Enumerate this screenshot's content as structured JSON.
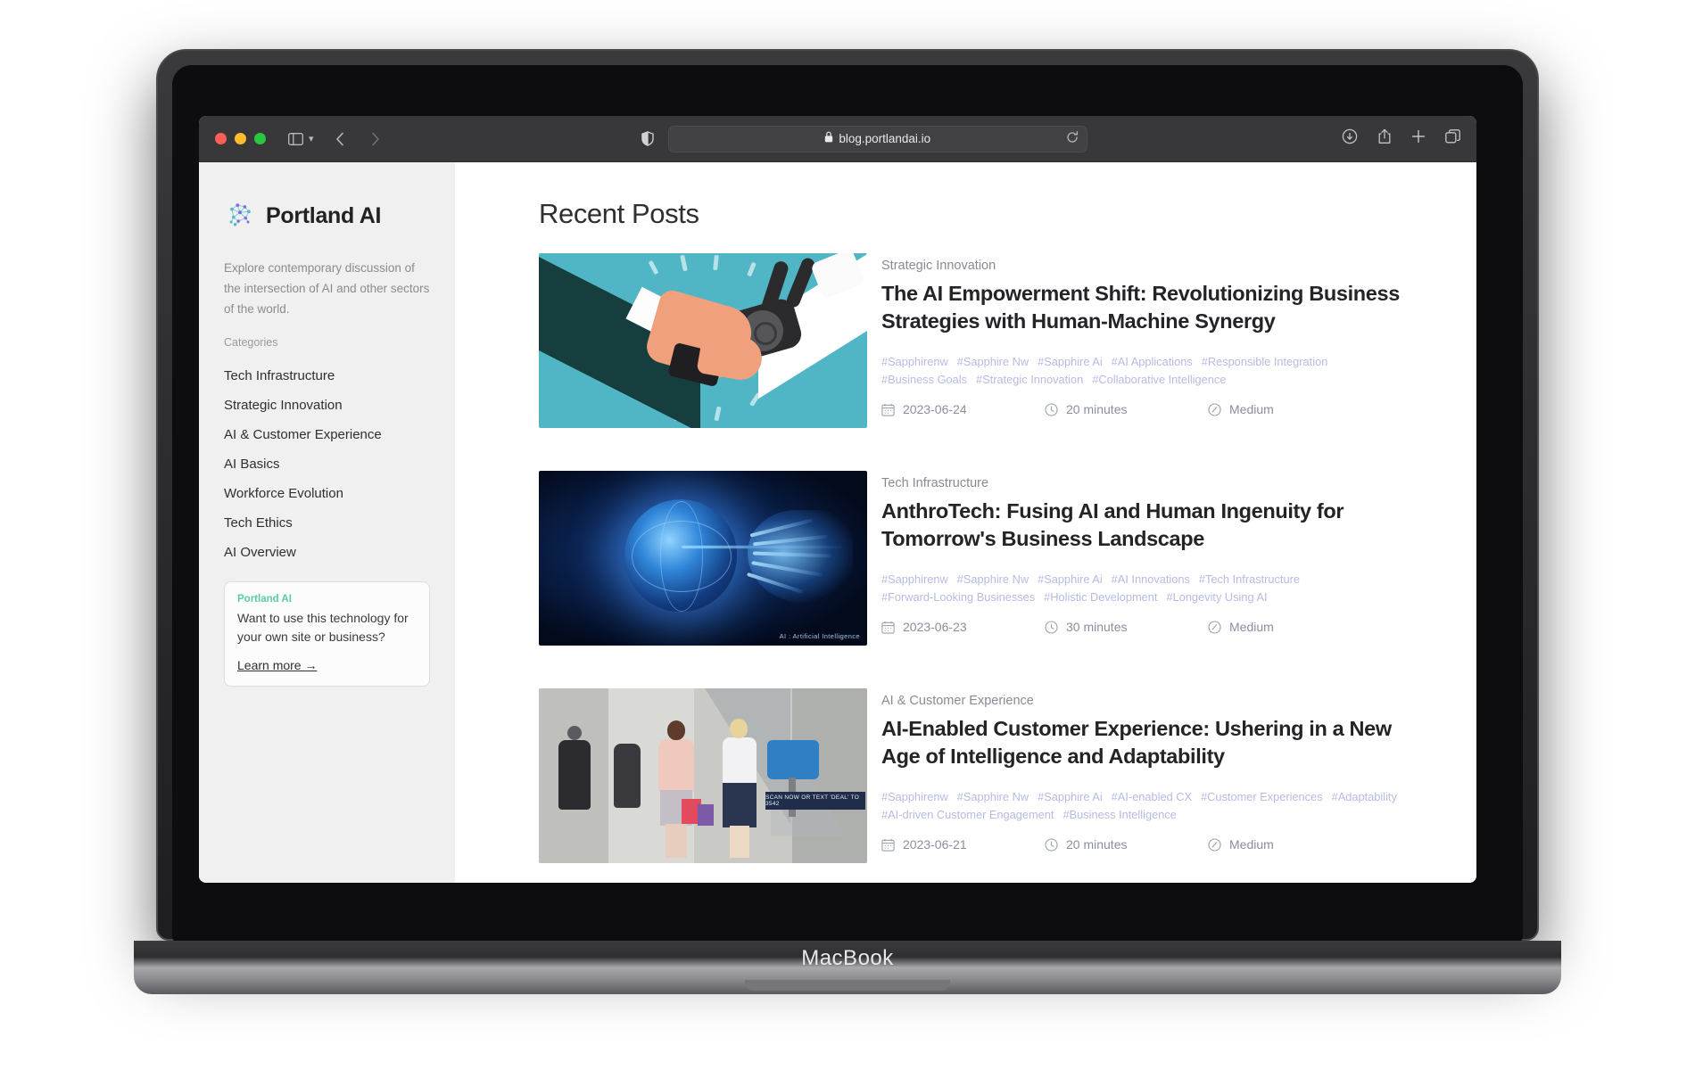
{
  "browser": {
    "url": "blog.portlandai.io",
    "lock_icon": "lock-icon",
    "sidebar_toggle_icon": "sidebar-toggle-icon",
    "back_icon": "back-arrow-icon",
    "forward_icon": "forward-arrow-icon",
    "shield_icon": "privacy-shield-icon",
    "reload_icon": "reload-icon",
    "download_icon": "download-icon",
    "share_icon": "share-icon",
    "new_tab_icon": "plus-icon",
    "tabs_icon": "tab-overview-icon"
  },
  "device": {
    "label": "MacBook"
  },
  "sidebar": {
    "brand": "Portland AI",
    "logo_icon": "brain-network-logo-icon",
    "tagline": "Explore contemporary discussion of the intersection of AI and other sectors of the world.",
    "categories_heading": "Categories",
    "categories": [
      "Tech Infrastructure",
      "Strategic Innovation",
      "AI & Customer Experience",
      "AI Basics",
      "Workforce Evolution",
      "Tech Ethics",
      "AI Overview"
    ],
    "promo": {
      "label": "Portland AI",
      "label_color": "#5ec9a7",
      "text": "Want to use this technology for your own site or business?",
      "link": "Learn more →"
    }
  },
  "main": {
    "title": "Recent Posts",
    "meta_icons": {
      "date": "calendar-icon",
      "duration": "clock-icon",
      "difficulty": "gauge-icon"
    },
    "posts": [
      {
        "category": "Strategic Innovation",
        "title": "The AI Empowerment Shift: Revolutionizing Business Strategies with Human-Machine Synergy",
        "thumbnail": "human-robot-handshake-illustration",
        "tags": [
          "#Sapphirenw",
          "#Sapphire Nw",
          "#Sapphire Ai",
          "#AI Applications",
          "#Responsible Integration",
          "#Business Goals",
          "#Strategic Innovation",
          "#Collaborative Intelligence"
        ],
        "date": "2023-06-24",
        "duration": "20 minutes",
        "difficulty": "Medium"
      },
      {
        "category": "Tech Infrastructure",
        "title": "AnthroTech: Fusing AI and Human Ingenuity for Tomorrow's Business Landscape",
        "thumbnail": "glowing-globe-and-digital-hand-illustration",
        "thumbnail_caption": "AI : Artificial Intelligence",
        "tags": [
          "#Sapphirenw",
          "#Sapphire Nw",
          "#Sapphire Ai",
          "#AI Innovations",
          "#Tech Infrastructure",
          "#Forward-Looking Businesses",
          "#Holistic Development",
          "#Longevity Using AI"
        ],
        "date": "2023-06-23",
        "duration": "30 minutes",
        "difficulty": "Medium"
      },
      {
        "category": "AI & Customer Experience",
        "title": "AI-Enabled Customer Experience: Ushering in a New Age of Intelligence and Adaptability",
        "thumbnail": "retail-store-shoppers-photo",
        "thumbnail_caption": "SCAN NOW OR TEXT 'DEAL' TO 3542",
        "tags": [
          "#Sapphirenw",
          "#Sapphire Nw",
          "#Sapphire Ai",
          "#AI-enabled CX",
          "#Customer Experiences",
          "#Adaptability",
          "#AI-driven Customer Engagement",
          "#Business Intelligence"
        ],
        "date": "2023-06-21",
        "duration": "20 minutes",
        "difficulty": "Medium"
      }
    ]
  }
}
